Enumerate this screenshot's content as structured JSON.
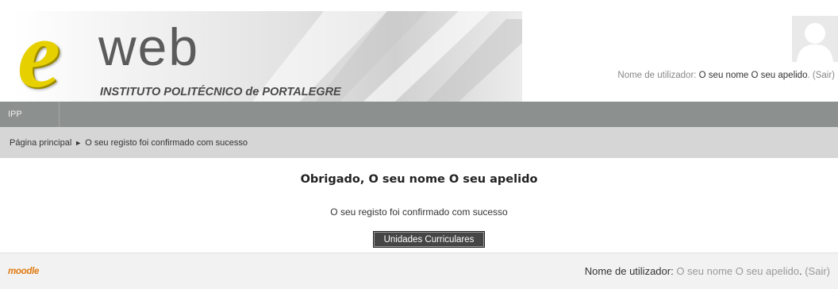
{
  "header": {
    "logo": {
      "letter": "e",
      "word": "web",
      "subtitle": "INSTITUTO POLITÉCNICO de PORTALEGRE"
    },
    "login": {
      "prefix": "Nome de utilizador: ",
      "user_name": "O seu nome O seu apelido",
      "separator": ". ",
      "logout": "(Sair)"
    },
    "avatar_icon": "user-avatar-icon"
  },
  "menu": {
    "items": [
      {
        "label": "IPP"
      }
    ]
  },
  "breadcrumb": {
    "home": "Página principal",
    "separator": "►",
    "current": "O seu registo foi confirmado com sucesso"
  },
  "main": {
    "heading": "Obrigado, O seu nome O seu apelido",
    "message": "O seu registo foi confirmado com sucesso",
    "button_label": "Unidades Curriculares"
  },
  "footer": {
    "logo_text": "moodle",
    "login": {
      "prefix": "Nome de utilizador: ",
      "user_name": "O seu nome O seu apelido",
      "separator": ". ",
      "logout": "(Sair)"
    }
  },
  "colors": {
    "menubar": "#8c9190",
    "navbar": "#d6d6d6",
    "logo_yellow": "#e6d000",
    "moodle_orange": "#e07a10",
    "button": "#454545"
  }
}
